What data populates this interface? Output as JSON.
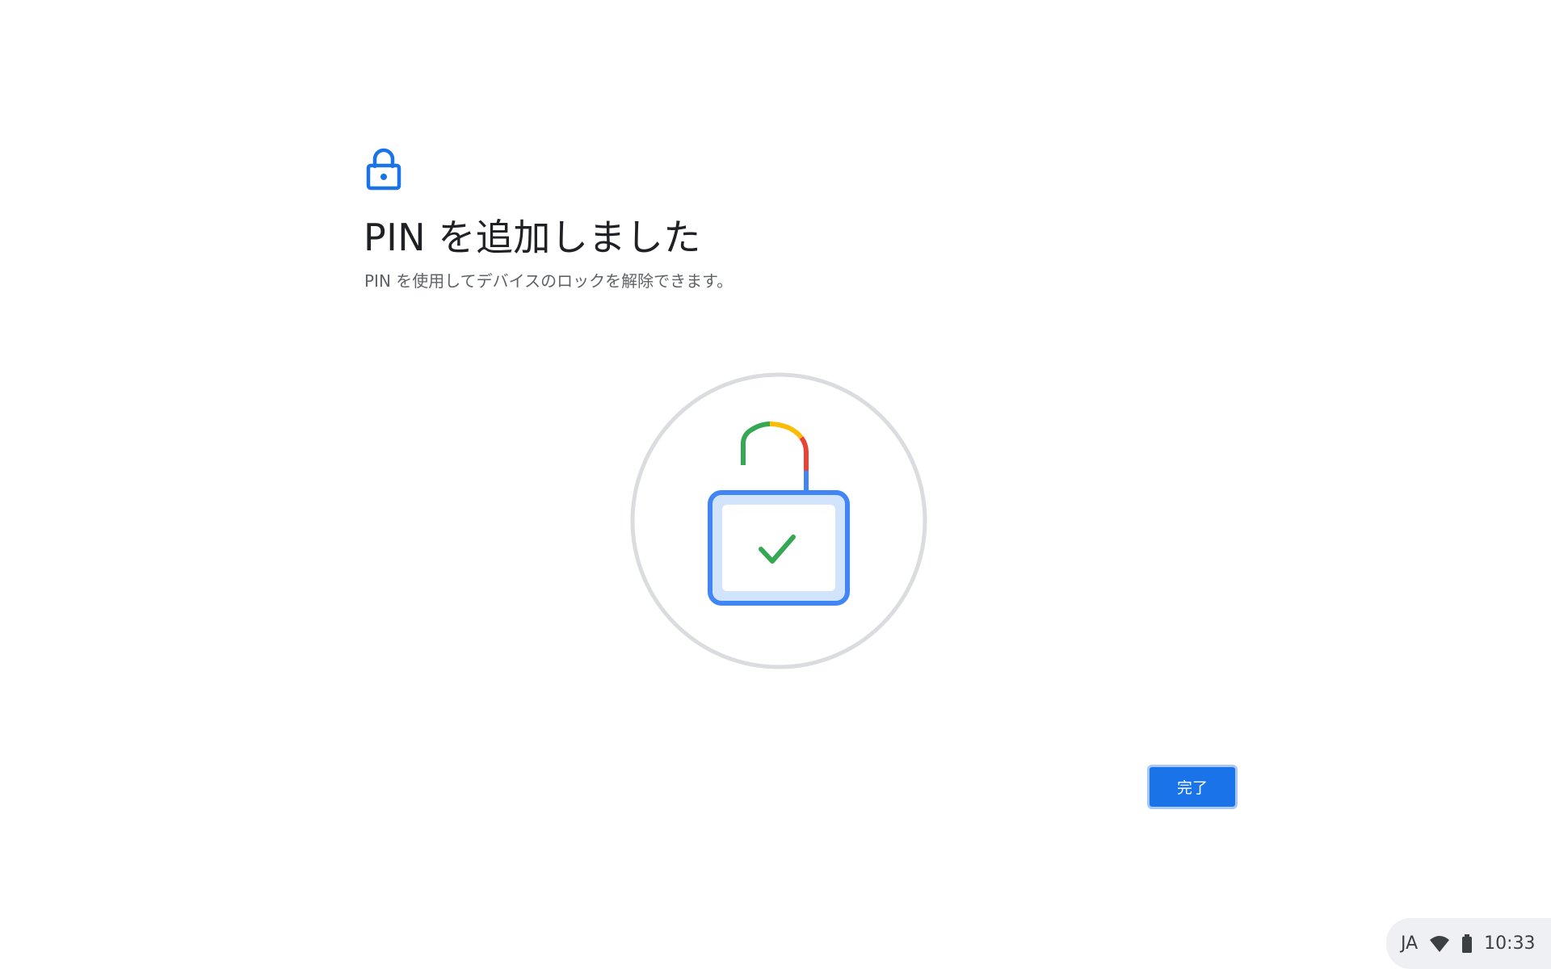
{
  "dialog": {
    "header_icon": "lock-icon",
    "title": "PIN を追加しました",
    "subtitle": "PIN を使用してデバイスのロックを解除できます。",
    "illustration_icon": "unlocked-padlock-check-icon",
    "done_label": "完了"
  },
  "status_tray": {
    "ime_label": "JA",
    "wifi_icon": "wifi-icon",
    "battery_icon": "battery-icon",
    "time": "10:33"
  },
  "colors": {
    "accent": "#1a73e8",
    "google_green": "#34a853",
    "google_yellow": "#fbbc04",
    "google_red": "#ea4335",
    "google_blue": "#4285f4"
  }
}
